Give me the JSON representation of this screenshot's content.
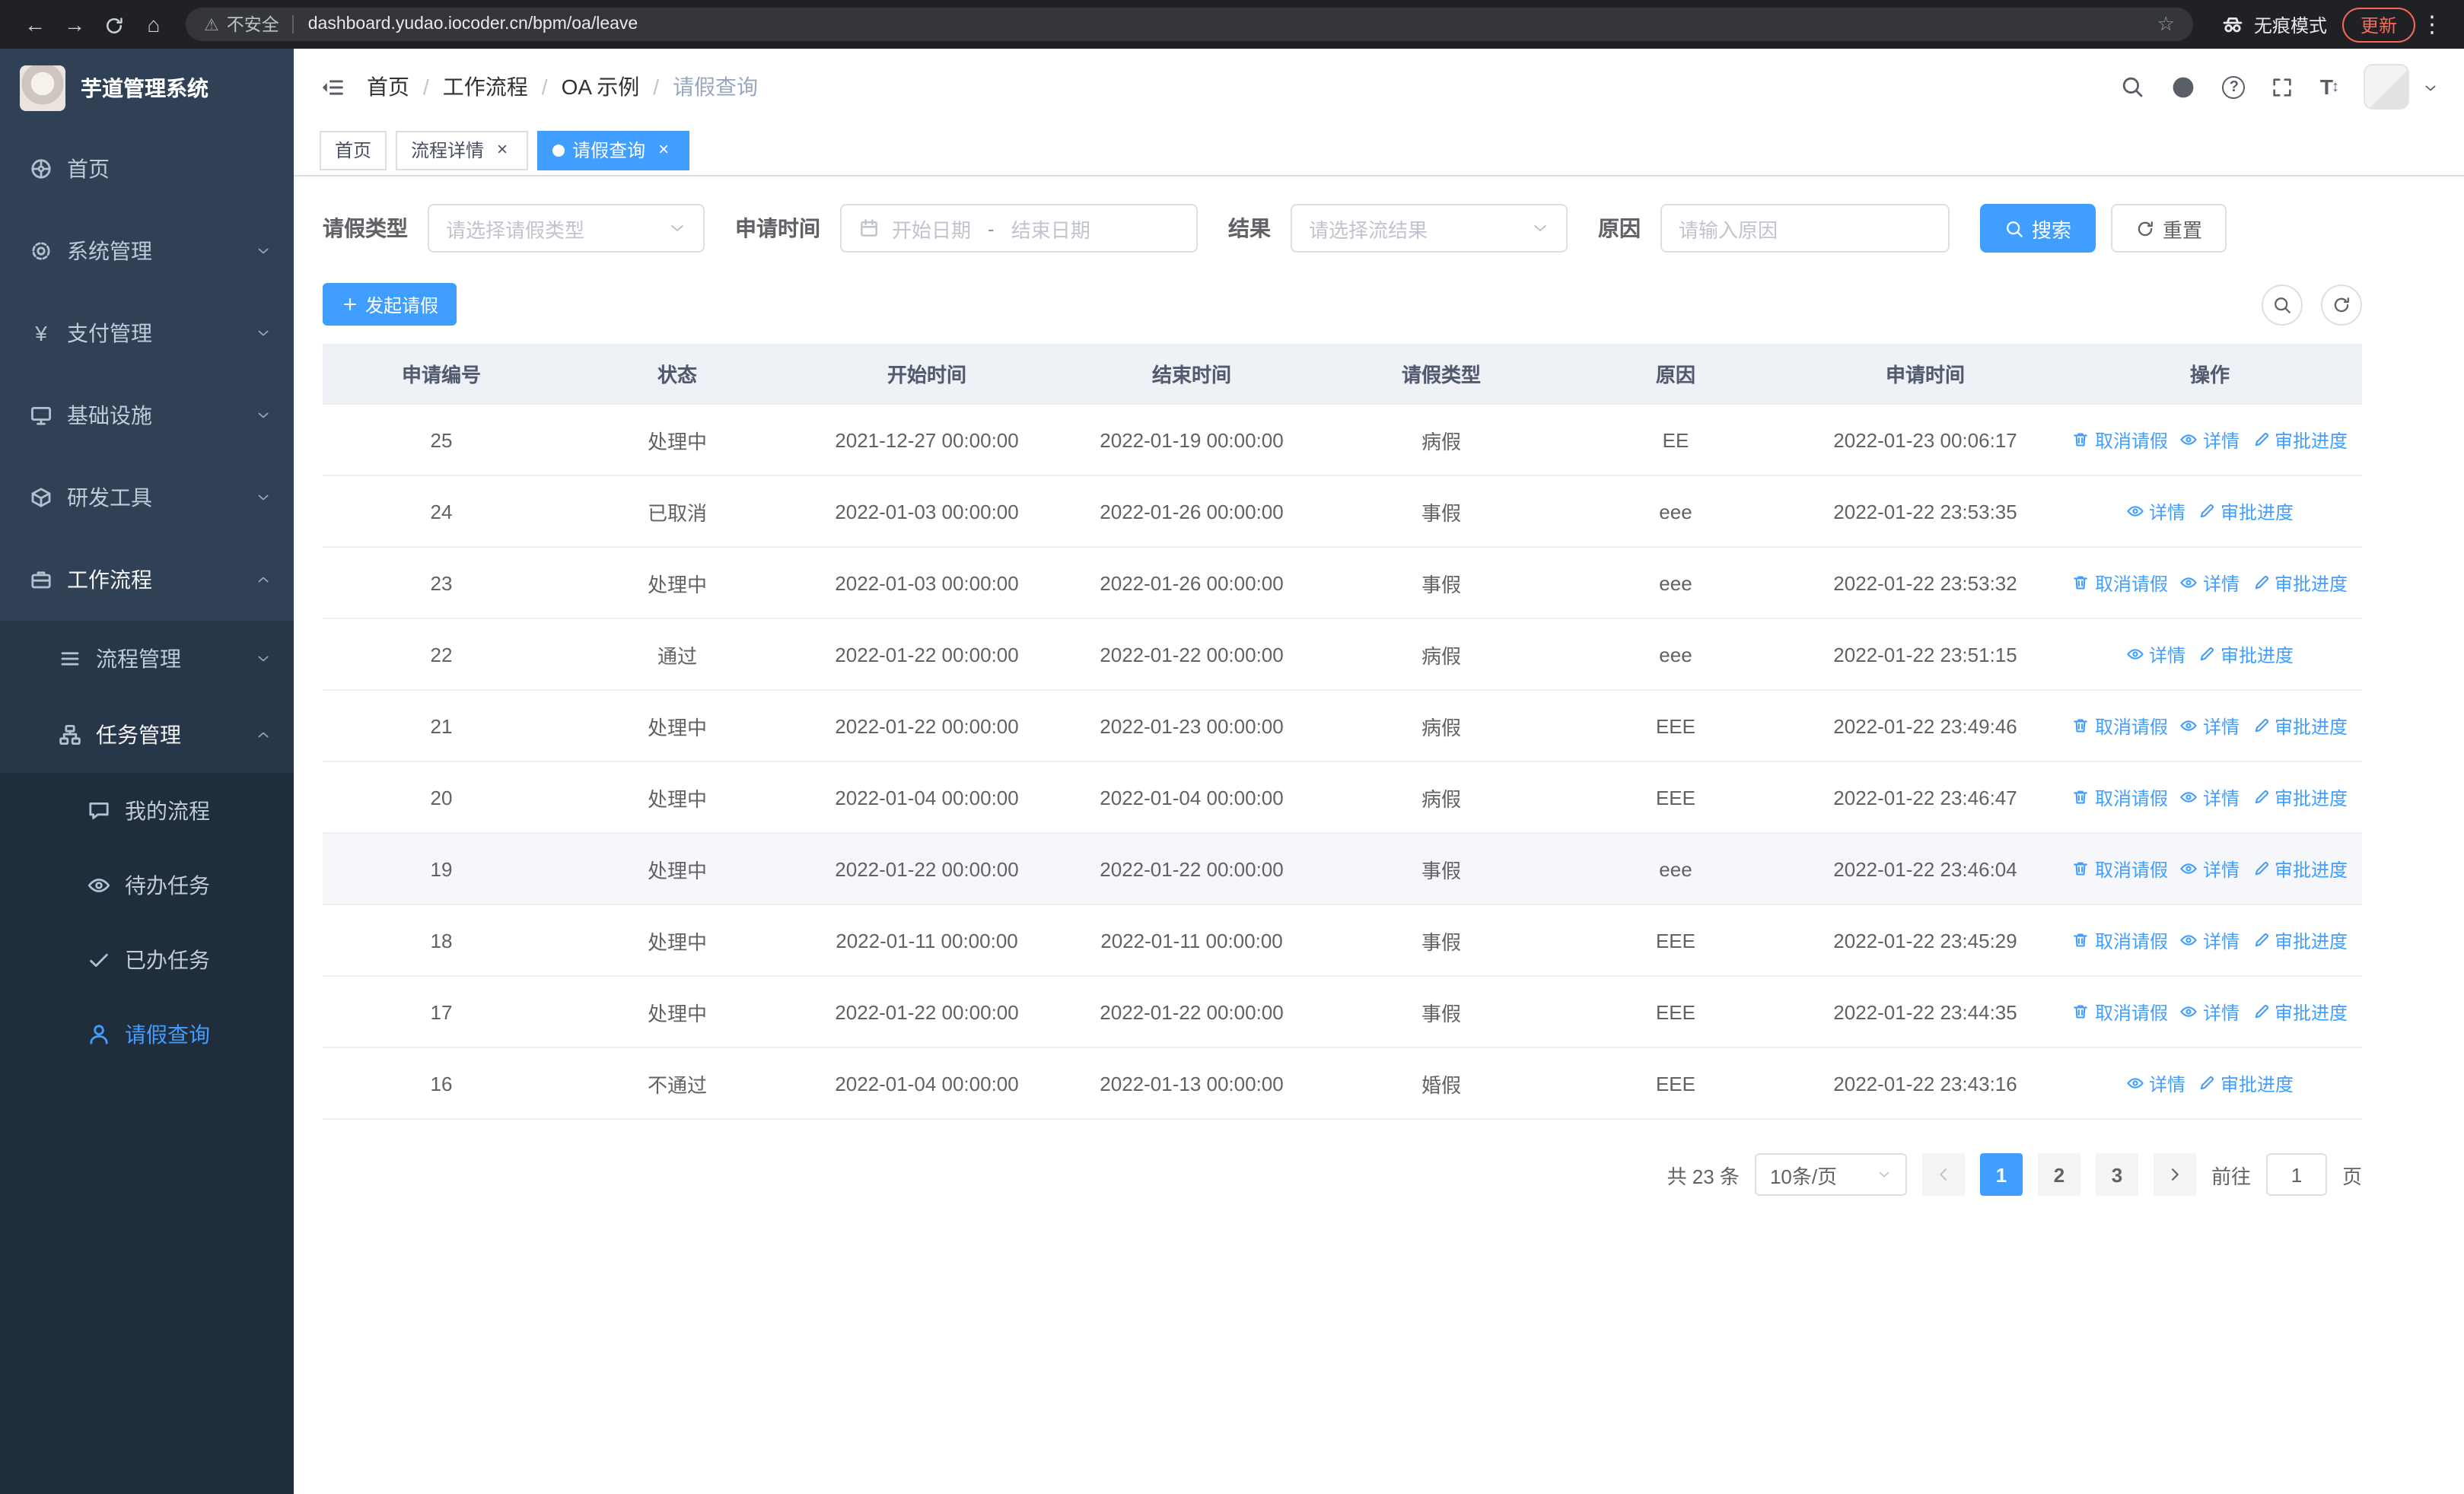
{
  "icons": {
    "back": "←",
    "forward": "→",
    "home": "⌂",
    "warning": "⚠",
    "star": "☆",
    "kebab": "⋮",
    "payment_glyph": "¥",
    "question_glyph": "?",
    "font_size_glyph": "T",
    "font_size_arrows": "↕",
    "tab_close": "×"
  },
  "browser": {
    "security_label": "不安全",
    "url": "dashboard.yudao.iocoder.cn/bpm/oa/leave",
    "incognito_label": "无痕模式",
    "update_label": "更新"
  },
  "sidebar": {
    "logo_title": "芋道管理系统",
    "menu": [
      {
        "label": "首页"
      },
      {
        "label": "系统管理"
      },
      {
        "label": "支付管理"
      },
      {
        "label": "基础设施"
      },
      {
        "label": "研发工具"
      },
      {
        "label": "工作流程"
      },
      {
        "label": "流程管理"
      },
      {
        "label": "任务管理"
      },
      {
        "label": "我的流程"
      },
      {
        "label": "待办任务"
      },
      {
        "label": "已办任务"
      },
      {
        "label": "请假查询"
      }
    ]
  },
  "header": {
    "breadcrumb": [
      "首页",
      "工作流程",
      "OA 示例",
      "请假查询"
    ]
  },
  "tabs": [
    {
      "label": "首页"
    },
    {
      "label": "流程详情"
    },
    {
      "label": "请假查询"
    }
  ],
  "filters": {
    "leave_type_label": "请假类型",
    "leave_type_placeholder": "请选择请假类型",
    "apply_time_label": "申请时间",
    "start_date_placeholder": "开始日期",
    "date_separator": "-",
    "end_date_placeholder": "结束日期",
    "result_label": "结果",
    "result_placeholder": "请选择流结果",
    "reason_label": "原因",
    "reason_placeholder": "请输入原因",
    "search_label": "搜索",
    "reset_label": "重置"
  },
  "toolbar": {
    "create_label": "发起请假"
  },
  "table": {
    "columns": [
      "申请编号",
      "状态",
      "开始时间",
      "结束时间",
      "请假类型",
      "原因",
      "申请时间",
      "操作"
    ],
    "actions": {
      "cancel": "取消请假",
      "detail": "详情",
      "progress": "审批进度"
    },
    "rows": [
      {
        "id": "25",
        "status": "处理中",
        "start": "2021-12-27 00:00:00",
        "end": "2022-01-19 00:00:00",
        "type": "病假",
        "reason": "EE",
        "applied": "2022-01-23 00:06:17",
        "cancelable": true,
        "highlight": false
      },
      {
        "id": "24",
        "status": "已取消",
        "start": "2022-01-03 00:00:00",
        "end": "2022-01-26 00:00:00",
        "type": "事假",
        "reason": "eee",
        "applied": "2022-01-22 23:53:35",
        "cancelable": false,
        "highlight": false
      },
      {
        "id": "23",
        "status": "处理中",
        "start": "2022-01-03 00:00:00",
        "end": "2022-01-26 00:00:00",
        "type": "事假",
        "reason": "eee",
        "applied": "2022-01-22 23:53:32",
        "cancelable": true,
        "highlight": false
      },
      {
        "id": "22",
        "status": "通过",
        "start": "2022-01-22 00:00:00",
        "end": "2022-01-22 00:00:00",
        "type": "病假",
        "reason": "eee",
        "applied": "2022-01-22 23:51:15",
        "cancelable": false,
        "highlight": false
      },
      {
        "id": "21",
        "status": "处理中",
        "start": "2022-01-22 00:00:00",
        "end": "2022-01-23 00:00:00",
        "type": "病假",
        "reason": "EEE",
        "applied": "2022-01-22 23:49:46",
        "cancelable": true,
        "highlight": false
      },
      {
        "id": "20",
        "status": "处理中",
        "start": "2022-01-04 00:00:00",
        "end": "2022-01-04 00:00:00",
        "type": "病假",
        "reason": "EEE",
        "applied": "2022-01-22 23:46:47",
        "cancelable": true,
        "highlight": false
      },
      {
        "id": "19",
        "status": "处理中",
        "start": "2022-01-22 00:00:00",
        "end": "2022-01-22 00:00:00",
        "type": "事假",
        "reason": "eee",
        "applied": "2022-01-22 23:46:04",
        "cancelable": true,
        "highlight": true
      },
      {
        "id": "18",
        "status": "处理中",
        "start": "2022-01-11 00:00:00",
        "end": "2022-01-11 00:00:00",
        "type": "事假",
        "reason": "EEE",
        "applied": "2022-01-22 23:45:29",
        "cancelable": true,
        "highlight": false
      },
      {
        "id": "17",
        "status": "处理中",
        "start": "2022-01-22 00:00:00",
        "end": "2022-01-22 00:00:00",
        "type": "事假",
        "reason": "EEE",
        "applied": "2022-01-22 23:44:35",
        "cancelable": true,
        "highlight": false
      },
      {
        "id": "16",
        "status": "不通过",
        "start": "2022-01-04 00:00:00",
        "end": "2022-01-13 00:00:00",
        "type": "婚假",
        "reason": "EEE",
        "applied": "2022-01-22 23:43:16",
        "cancelable": false,
        "highlight": false
      }
    ]
  },
  "pagination": {
    "total_label": "共 23 条",
    "page_size_label": "10条/页",
    "pages": [
      "1",
      "2",
      "3"
    ],
    "active_page": "1",
    "goto_label": "前往",
    "goto_value": "1",
    "page_unit": "页"
  }
}
